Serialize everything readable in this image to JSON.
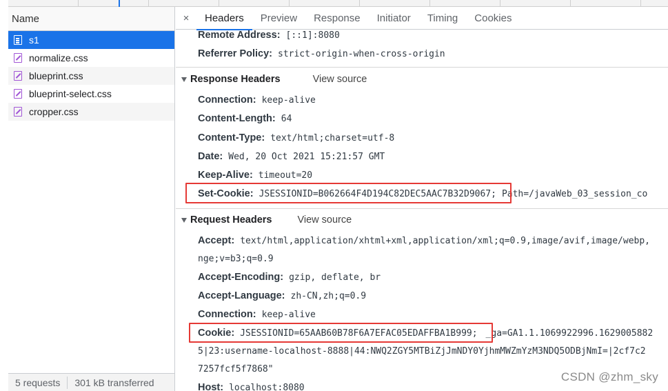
{
  "left_panel": {
    "column_header": "Name",
    "requests": [
      {
        "name": "s1",
        "type": "document",
        "selected": true
      },
      {
        "name": "normalize.css",
        "type": "stylesheet",
        "selected": false
      },
      {
        "name": "blueprint.css",
        "type": "stylesheet",
        "selected": false
      },
      {
        "name": "blueprint-select.css",
        "type": "stylesheet",
        "selected": false
      },
      {
        "name": "cropper.css",
        "type": "stylesheet",
        "selected": false
      }
    ],
    "status": {
      "requests": "5 requests",
      "transferred": "301 kB transferred"
    }
  },
  "tabs": {
    "close": "×",
    "items": [
      "Headers",
      "Preview",
      "Response",
      "Initiator",
      "Timing",
      "Cookies"
    ],
    "active": "Headers"
  },
  "general": {
    "remote_address_key": "Remote Address:",
    "remote_address_value": "[::1]:8080",
    "referrer_policy_key": "Referrer Policy:",
    "referrer_policy_value": "strict-origin-when-cross-origin"
  },
  "response_headers": {
    "title": "Response Headers",
    "view_source": "View source",
    "rows": [
      {
        "key": "Connection:",
        "value": "keep-alive"
      },
      {
        "key": "Content-Length:",
        "value": "64"
      },
      {
        "key": "Content-Type:",
        "value": "text/html;charset=utf-8"
      },
      {
        "key": "Date:",
        "value": "Wed, 20 Oct 2021 15:21:57 GMT"
      },
      {
        "key": "Keep-Alive:",
        "value": "timeout=20"
      }
    ],
    "set_cookie": {
      "key": "Set-Cookie:",
      "value": "JSESSIONID=B062664F4D194C82DEC5AAC7B32D9067;",
      "rest": "Path=/javaWeb_03_session_co"
    }
  },
  "request_headers": {
    "title": "Request Headers",
    "view_source": "View source",
    "accept": {
      "key": "Accept:",
      "value": "text/html,application/xhtml+xml,application/xml;q=0.9,image/avif,image/webp,",
      "cont": "nge;v=b3;q=0.9"
    },
    "rows": [
      {
        "key": "Accept-Encoding:",
        "value": "gzip, deflate, br"
      },
      {
        "key": "Accept-Language:",
        "value": "zh-CN,zh;q=0.9"
      },
      {
        "key": "Connection:",
        "value": "keep-alive"
      }
    ],
    "cookie": {
      "key": "Cookie:",
      "value": "JSESSIONID=65AAB60B78F6A7EFAC05EDAFFBA1B999;",
      "rest": "_ga=GA1.1.1069922996.1629005882",
      "cont1": "5|23:username-localhost-8888|44:NWQ2ZGY5MTBiZjJmNDY0YjhmMWZmYzM3NDQ5ODBjNmI=|2cf7c2",
      "cont2": "7257fcf5f7868\""
    },
    "host": {
      "key": "Host:",
      "value": "localhost:8080"
    }
  },
  "watermark": "CSDN @zhm_sky",
  "colors": {
    "accent": "#1a73e8",
    "highlight_box": "#e53935",
    "css_icon": "#a155d6"
  }
}
